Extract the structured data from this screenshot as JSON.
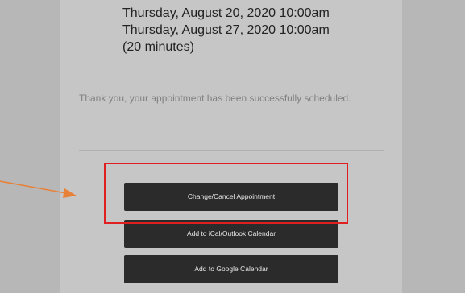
{
  "appointment": {
    "slots": [
      "Thursday, August 20, 2020 10:00am",
      "Thursday, August 27, 2020 10:00am",
      "(20 minutes)"
    ],
    "confirmation_message": "Thank you, your appointment has been successfully scheduled."
  },
  "actions": {
    "change_cancel_label": "Change/Cancel Appointment",
    "ical_outlook_label": "Add to iCal/Outlook Calendar",
    "google_calendar_label": "Add to Google Calendar"
  },
  "annotation": {
    "highlight_color": "#e02020",
    "arrow_color": "#e8823a"
  },
  "colors": {
    "page_background": "#b7b7b7",
    "panel_background": "#c6c6c6",
    "button_background": "#2b2b2b"
  }
}
